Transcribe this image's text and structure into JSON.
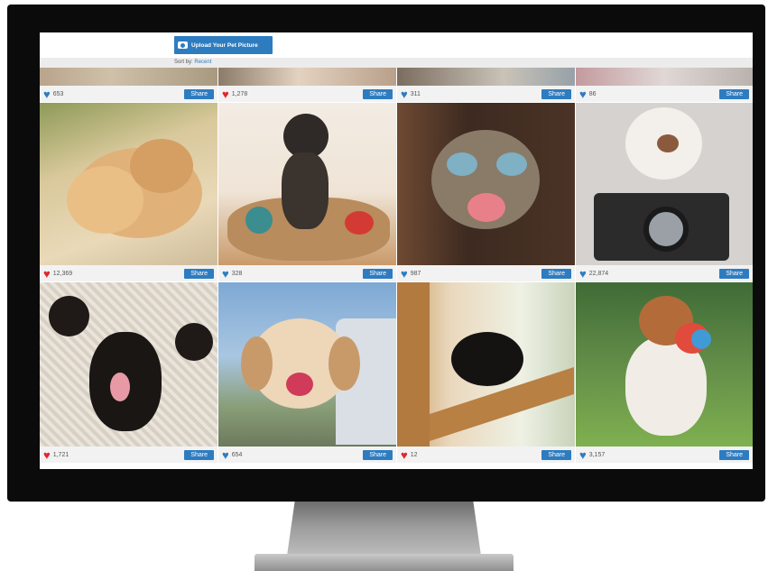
{
  "header": {
    "upload_label": "Upload Your Pet Picture",
    "sort_label": "Sort by:",
    "sort_value": "Recent"
  },
  "colors": {
    "accent": "#2e7cc0",
    "heart_red": "#e0262e",
    "heart_blue": "#2e7cc0"
  },
  "share_label": "Share",
  "rows": [
    {
      "cells": [
        {
          "count": "653",
          "heart": "blue"
        },
        {
          "count": "1,278",
          "heart": "red"
        },
        {
          "count": "311",
          "heart": "blue"
        },
        {
          "count": "86",
          "heart": "blue"
        }
      ]
    },
    {
      "cells": [
        {
          "count": "12,369",
          "heart": "red"
        },
        {
          "count": "328",
          "heart": "blue"
        },
        {
          "count": "987",
          "heart": "blue"
        },
        {
          "count": "22,874",
          "heart": "blue"
        }
      ]
    },
    {
      "cells": [
        {
          "count": "1,721",
          "heart": "red"
        },
        {
          "count": "654",
          "heart": "blue"
        },
        {
          "count": "12",
          "heart": "red"
        },
        {
          "count": "3,157",
          "heart": "blue"
        }
      ]
    }
  ]
}
